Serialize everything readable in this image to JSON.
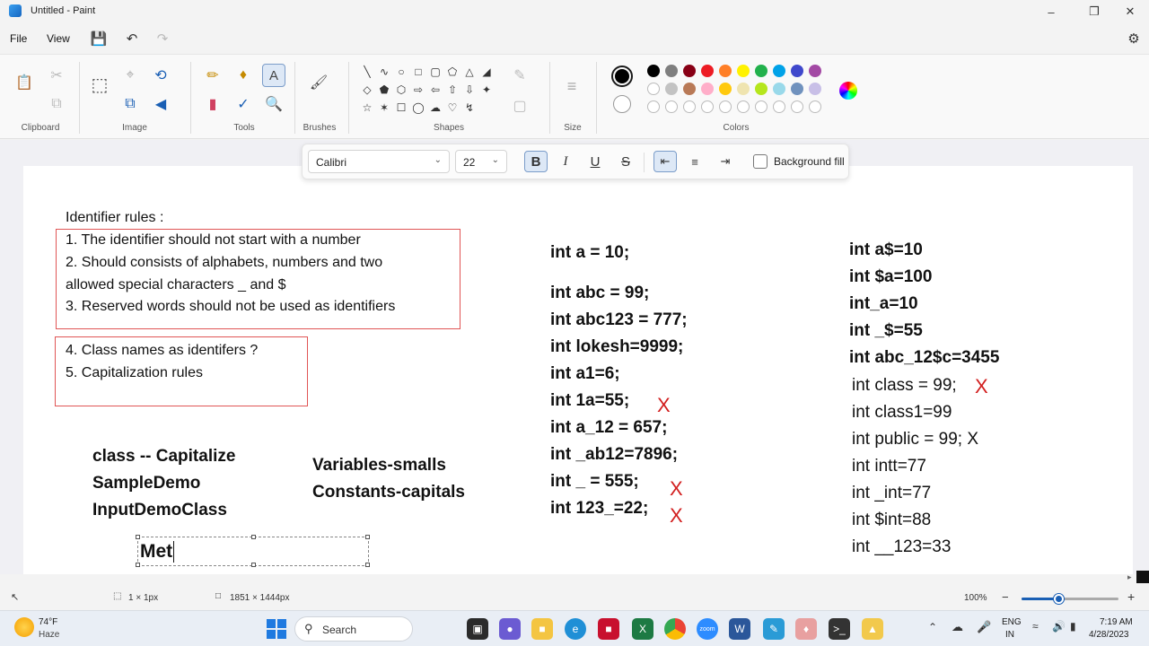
{
  "window": {
    "title": "Untitled - Paint"
  },
  "menu": {
    "file": "File",
    "view": "View"
  },
  "ribbon": {
    "groups": {
      "clipboard": "Clipboard",
      "image": "Image",
      "tools": "Tools",
      "brushes": "Brushes",
      "shapes": "Shapes",
      "size": "Size",
      "colors": "Colors"
    },
    "colors_row1": [
      "#000000",
      "#7f7f7f",
      "#880015",
      "#ed1c24",
      "#ff7f27",
      "#fff200",
      "#22b14c",
      "#00a2e8",
      "#3f48cc",
      "#a349a4"
    ],
    "colors_row2": [
      "#ffffff",
      "#c3c3c3",
      "#b97a57",
      "#ffaec9",
      "#ffc90e",
      "#efe4b0",
      "#b5e61d",
      "#99d9ea",
      "#7092be",
      "#c8bfe7"
    ],
    "primary_color": "#000000",
    "secondary_color": "#ffffff"
  },
  "text_toolbar": {
    "font": "Calibri",
    "size": "22",
    "bold_label": "B",
    "italic_label": "I",
    "underline_label": "U",
    "strike_label": "S",
    "background_fill_label": "Background fill"
  },
  "canvas": {
    "heading": "Identifier rules :",
    "rules": [
      "1. The identifier should not start with a number",
      "2. Should consists of alphabets, numbers and two",
      "allowed special characters _ and $",
      "3. Reserved words should not be used as identifiers"
    ],
    "rules2": [
      "4. Class names as identifers ?",
      "5. Capitalization rules"
    ],
    "class_notes": [
      "class -- Capitalize",
      "SampleDemo",
      "InputDemoClass"
    ],
    "var_notes": [
      "Variables-smalls",
      "Constants-capitals"
    ],
    "editing_text": "Met",
    "col_mid_first": "int a = 10;",
    "col_mid": [
      "int abc = 99;",
      "int abc123 = 777;",
      "int lokesh=9999;",
      "int a1=6;",
      "int 1a=55;",
      "int a_12 = 657;",
      "int _ab12=7896;",
      "int _ = 555;",
      "int 123_=22;"
    ],
    "col_right_bold": [
      "int a$=10",
      "int $a=100",
      "int_a=10",
      "int _$=55",
      "int abc_12$c=3455"
    ],
    "col_right_plain": [
      "int class = 99;",
      "int class1=99",
      "int public = 99; X",
      "int intt=77",
      "int _int=77",
      "int $int=88",
      "int __123=33"
    ],
    "x_mark": "X"
  },
  "status": {
    "selection": "1 × 1px",
    "canvas_size": "1851 × 1444px",
    "zoom": "100%"
  },
  "taskbar": {
    "weather_temp": "74°F",
    "weather_desc": "Haze",
    "search": "Search",
    "lang_line1": "ENG",
    "lang_line2": "IN",
    "time": "7:19 AM",
    "date": "4/28/2023"
  }
}
